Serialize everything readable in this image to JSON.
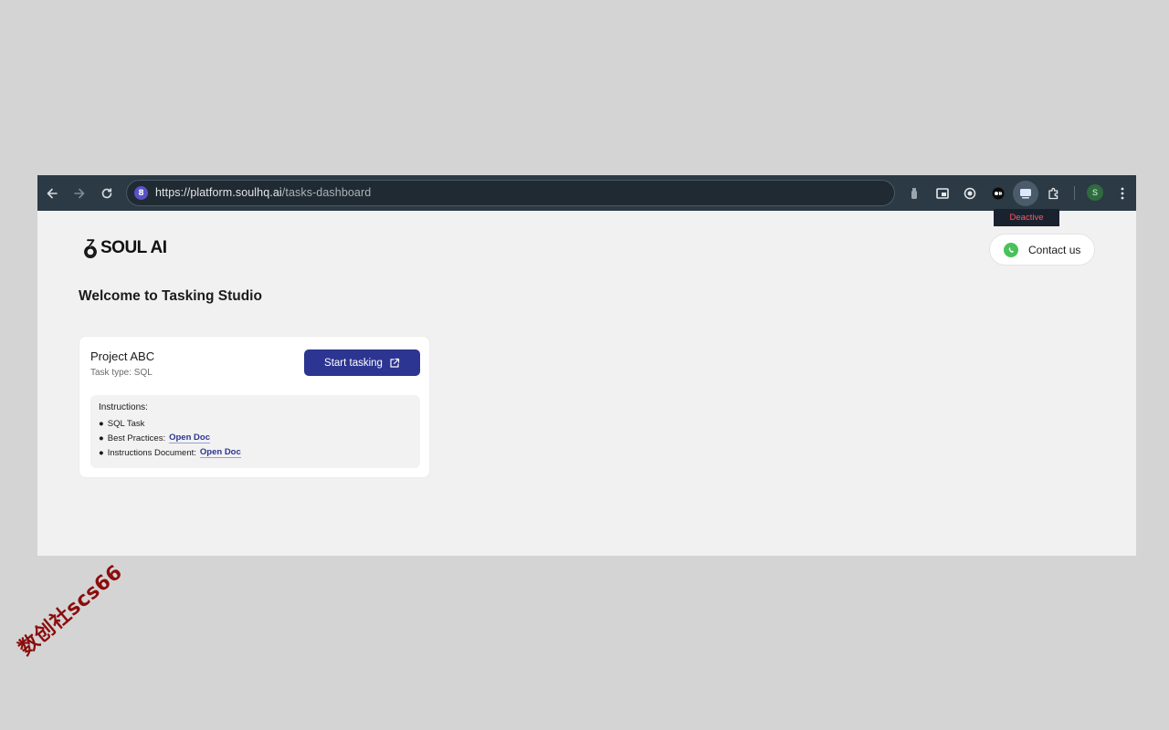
{
  "browser": {
    "url_host": "https://platform.soulhq.ai",
    "url_path": "/tasks-dashboard",
    "site_badge": "8",
    "profile_initial": "S",
    "tooltip": "Deactive",
    "icons": [
      "back-arrow-icon",
      "forward-arrow-icon",
      "reload-icon",
      "bottle-extension-icon",
      "picture-in-picture-icon",
      "record-extension-icon",
      "medium-extension-icon",
      "screen-extension-icon",
      "puzzle-extensions-icon",
      "kebab-menu-icon"
    ]
  },
  "header": {
    "logo_text": "SOUL AI",
    "contact_label": "Contact us"
  },
  "main": {
    "welcome": "Welcome to Tasking Studio"
  },
  "project": {
    "title": "Project ABC",
    "task_type": "Task type: SQL",
    "start_label": "Start tasking",
    "instructions_title": "Instructions:",
    "items": [
      {
        "bullet": "●",
        "text": "SQL Task"
      },
      {
        "bullet": "●",
        "text": "Best Practices:",
        "link": "Open Doc"
      },
      {
        "bullet": "●",
        "text": "Instructions Document:",
        "link": "Open Doc"
      }
    ]
  },
  "watermark": "数创社scs66"
}
